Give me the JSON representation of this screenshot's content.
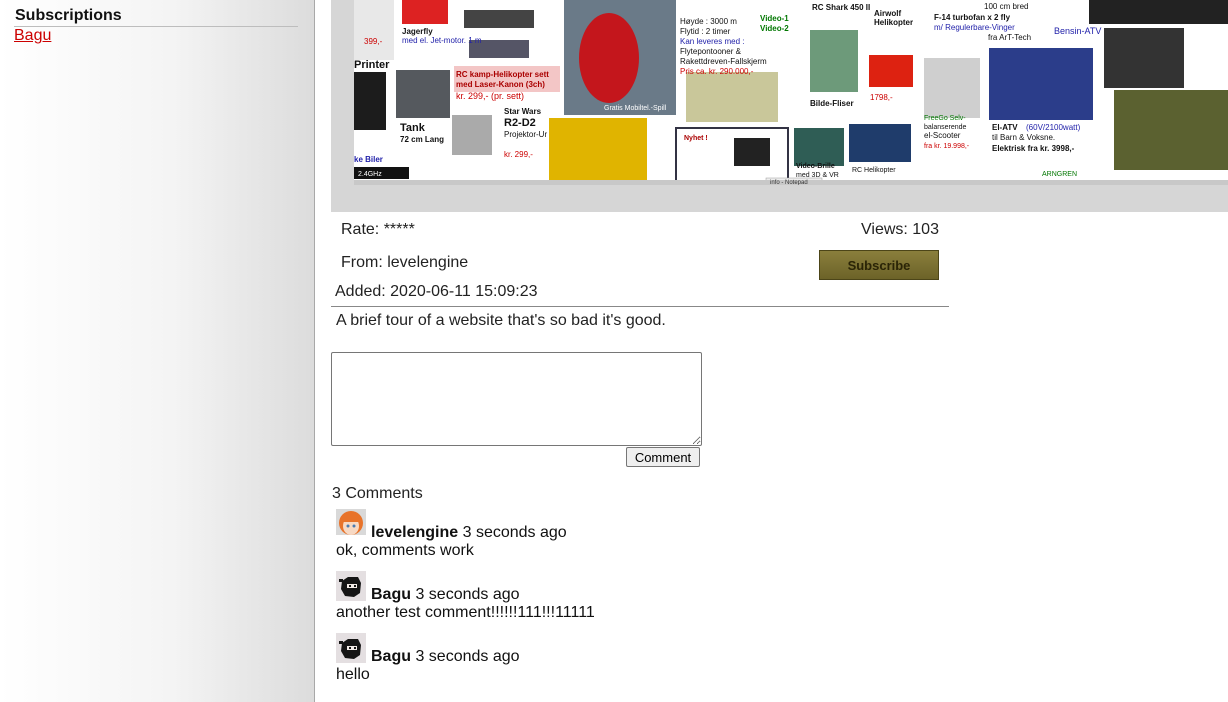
{
  "sidebar": {
    "heading": "Subscriptions",
    "subscriptions": [
      "Bagu"
    ]
  },
  "thumbnail": {
    "texts": [
      "Jagerfly",
      "med el. Jet-motor. 1 m",
      "399,-",
      "Printer",
      "RC kamp-Helikopter sett",
      "med Laser-Kanon (3ch)",
      "kr. 299,- (pr. sett)",
      "Tank",
      "72 cm Lang",
      "Star Wars",
      "R2-D2",
      "Projektor-Ur",
      "kr. 299,-",
      "Høyde : 3000 m",
      "Flytid : 2 timer",
      "Kan leveres med :",
      "Flytepontooner &",
      "Rakettdreven-Fallskjerm",
      "Pris ca. kr. 290.000,-",
      "Video-1",
      "Video-2",
      "Gratis Mobiltel.-Spill",
      "Nyhet !",
      "RC Shark 450 II",
      "Airwolf",
      "Helikopter",
      "Bilde-Fliser",
      "1798,-",
      "Video-Brille",
      "med 3D & VR",
      "RC Helikopter",
      "FreeGo Selv-",
      "balanserende",
      "el-Scooter",
      "fra kr. 19.998,-",
      "100 cm bred",
      "F-14 turbofan x 2 fly",
      "m/ Regulerbare-Vinger",
      "fra ArT-Tech",
      "Bensin-ATV",
      "El-ATV",
      "(60V/2100watt)",
      "til Barn & Voksne.",
      "Elektrisk fra kr. 3998,-",
      "ARNGREN",
      "2.4GHz",
      "ke Biler",
      "info - Notepad"
    ]
  },
  "video_info": {
    "rate_label": "Rate: *****",
    "views_label": "Views: 103",
    "from_label": "From: levelengine",
    "subscribe_label": "Subscribe",
    "added_label": "Added: 2020-06-11 15:09:23",
    "description": "A brief tour of a website that's so bad it's good."
  },
  "comment_form": {
    "textarea_value": "",
    "button_label": "Comment"
  },
  "comments_header": "3 Comments",
  "comments": [
    {
      "author": "levelengine",
      "time": "3 seconds ago",
      "text": "ok, comments work",
      "avatar": "anime-girl-avatar"
    },
    {
      "author": "Bagu",
      "time": "3 seconds ago",
      "text": "another test comment!!!!!!111!!!11111",
      "avatar": "ninja-avatar"
    },
    {
      "author": "Bagu",
      "time": "3 seconds ago",
      "text": "hello",
      "avatar": "ninja-avatar"
    }
  ],
  "colors": {
    "link": "#cc0000",
    "subscribe_bg": "#7a7032",
    "video_bg": "#d6d6d6"
  }
}
